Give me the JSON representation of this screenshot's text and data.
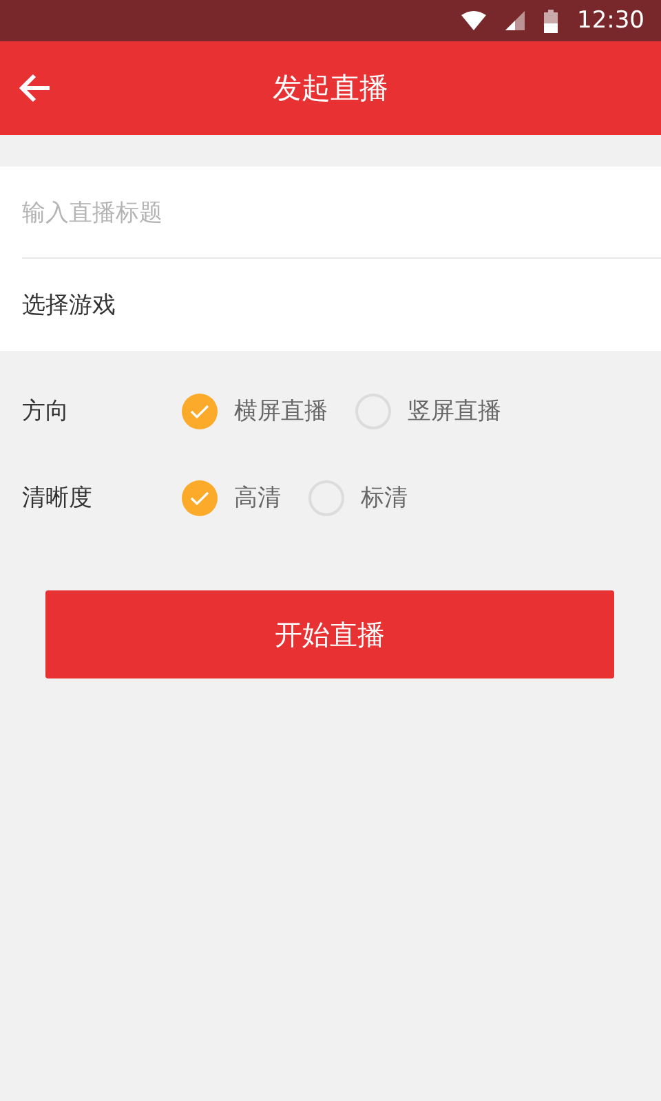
{
  "status_bar": {
    "time": "12:30"
  },
  "header": {
    "title": "发起直播"
  },
  "form": {
    "title_field": {
      "placeholder": "输入直播标题"
    },
    "game_field": {
      "value": "选择游戏"
    }
  },
  "option_groups": [
    {
      "label": "方向",
      "options": [
        {
          "label": "横屏直播",
          "selected": true
        },
        {
          "label": "竖屏直播",
          "selected": false
        }
      ]
    },
    {
      "label": "清晰度",
      "options": [
        {
          "label": "高清",
          "selected": true
        },
        {
          "label": "标清",
          "selected": false
        }
      ]
    }
  ],
  "start_button": "开始直播"
}
